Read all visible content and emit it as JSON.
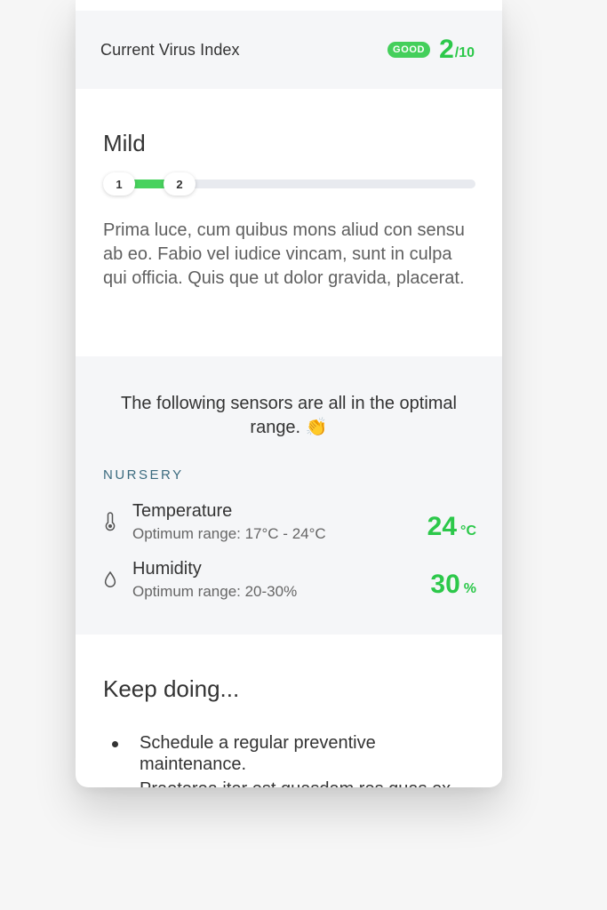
{
  "virus_index": {
    "label": "Current Virus Index",
    "badge": "GOOD",
    "score": "2",
    "score_of": "/10",
    "accent_color": "#2cc84a"
  },
  "severity": {
    "title": "Mild",
    "progress_min_label": "1",
    "progress_value_label": "2",
    "progress_value": 2,
    "progress_max": 10,
    "description": "Prima luce, cum quibus mons aliud con sensu ab eo. Fabio vel iudice vincam, sunt in culpa qui officia. Quis que ut dolor gravida, placerat."
  },
  "sensors": {
    "message": "The following sensors are all in the optimal range. 👏",
    "room": "NURSERY",
    "items": [
      {
        "icon": "thermometer-icon",
        "name": "Temperature",
        "range": "Optimum range: 17°C - 24°C",
        "value": "24",
        "unit": "°C"
      },
      {
        "icon": "droplet-icon",
        "name": "Humidity",
        "range": "Optimum range: 20-30%",
        "value": "30",
        "unit": "%"
      }
    ]
  },
  "keep_doing": {
    "title": "Keep doing...",
    "items": [
      "Schedule a regular preventive maintenance.",
      "Praeterea iter est quasdam res quas ex"
    ]
  }
}
